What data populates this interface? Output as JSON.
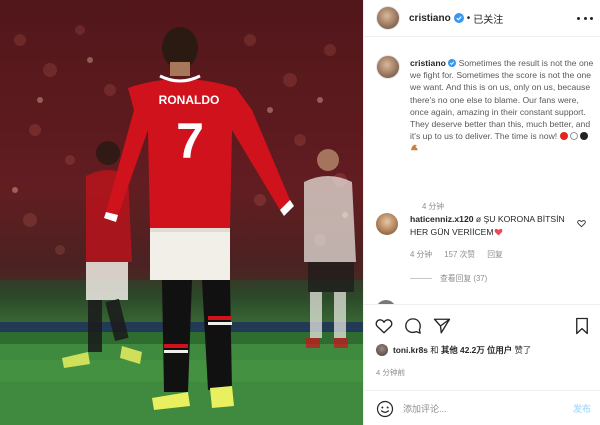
{
  "post": {
    "username": "cristiano",
    "follow_dot": "•",
    "follow_label": "已关注"
  },
  "photo": {
    "jersey_name": "RONALDO",
    "jersey_number": "7"
  },
  "caption": {
    "username": "cristiano",
    "text": "Sometimes the result is not the one we fight for. Sometimes the score is not the one we want. And this is on us, only on us, because there's no one else to blame. Our fans were, once again, amazing in their constant support. They deserve better than this, much better, and it's up to us to deliver. The time is now!",
    "emojis": [
      "red-circle",
      "white-circle",
      "black-circle",
      "flexed-biceps"
    ],
    "time": "4 分钟"
  },
  "comment": {
    "username": "haticenniz.x120",
    "text": "ø ŞU KORONA BİTSİN HER GÜN VERİİCEM",
    "emoji": "red-heart",
    "time": "4 分钟",
    "likes": "157 次赞",
    "reply_label": "回复",
    "view_replies": "查看回复 (37)"
  },
  "likes_line": {
    "user": "toni.kr8s",
    "connector": "和",
    "others": "其他",
    "count": "42.2万",
    "suffix": "位用户",
    "action": "赞了"
  },
  "post_time": "4 分钟前",
  "add_comment": {
    "placeholder": "添加评论...",
    "post_label": "发布"
  },
  "colors": {
    "jersey_red": "#d0121c",
    "verified_blue": "#3897f0",
    "heart_red": "#ed4956",
    "post_button": "#b2dffc"
  }
}
